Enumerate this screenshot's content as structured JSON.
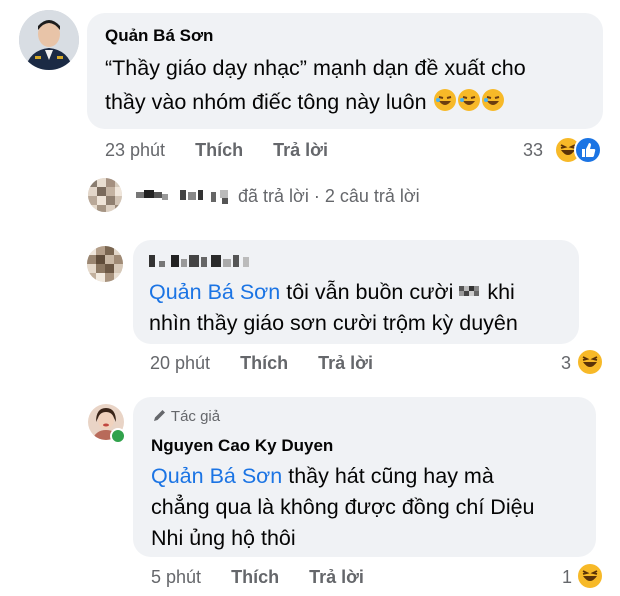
{
  "comment1": {
    "author": "Quản Bá Sơn",
    "text_line1": "“Thầy giáo dạy nhạc” mạnh dạn đề xuất cho",
    "text_line2": "thầy vào nhóm điếc tông này luôn",
    "time": "23 phút",
    "like": "Thích",
    "reply": "Trả lời",
    "reaction_count": "33",
    "reaction_icons": [
      "laughing-emoji",
      "like-thumb"
    ]
  },
  "replies_summary": {
    "text": "đã trả lời · 2 câu trả lời"
  },
  "reply1": {
    "mention": "Quản Bá Sơn",
    "text_line1_after": " tôi vẫn buồn cười",
    "text_line1_end": " khi",
    "text_line2": "nhìn thầy giáo sơn cười trộm kỳ duyên",
    "time": "20 phút",
    "like": "Thích",
    "reply": "Trả lời",
    "reaction_count": "3"
  },
  "reply2": {
    "badge": "Tác giả",
    "author": "Nguyen Cao Ky Duyen",
    "mention": "Quản Bá Sơn",
    "text_line1_after": " thầy hát cũng hay mà",
    "text_line2": "chẳng qua là không được đồng chí Diệu",
    "text_line3": "Nhi ủng hộ thôi",
    "time": "5 phút",
    "like": "Thích",
    "reply": "Trả lời",
    "reaction_count": "1"
  },
  "colors": {
    "bubble": "#f0f2f5",
    "mention": "#1b74e4",
    "secondary_text": "#65676b",
    "online": "#31a24c"
  }
}
